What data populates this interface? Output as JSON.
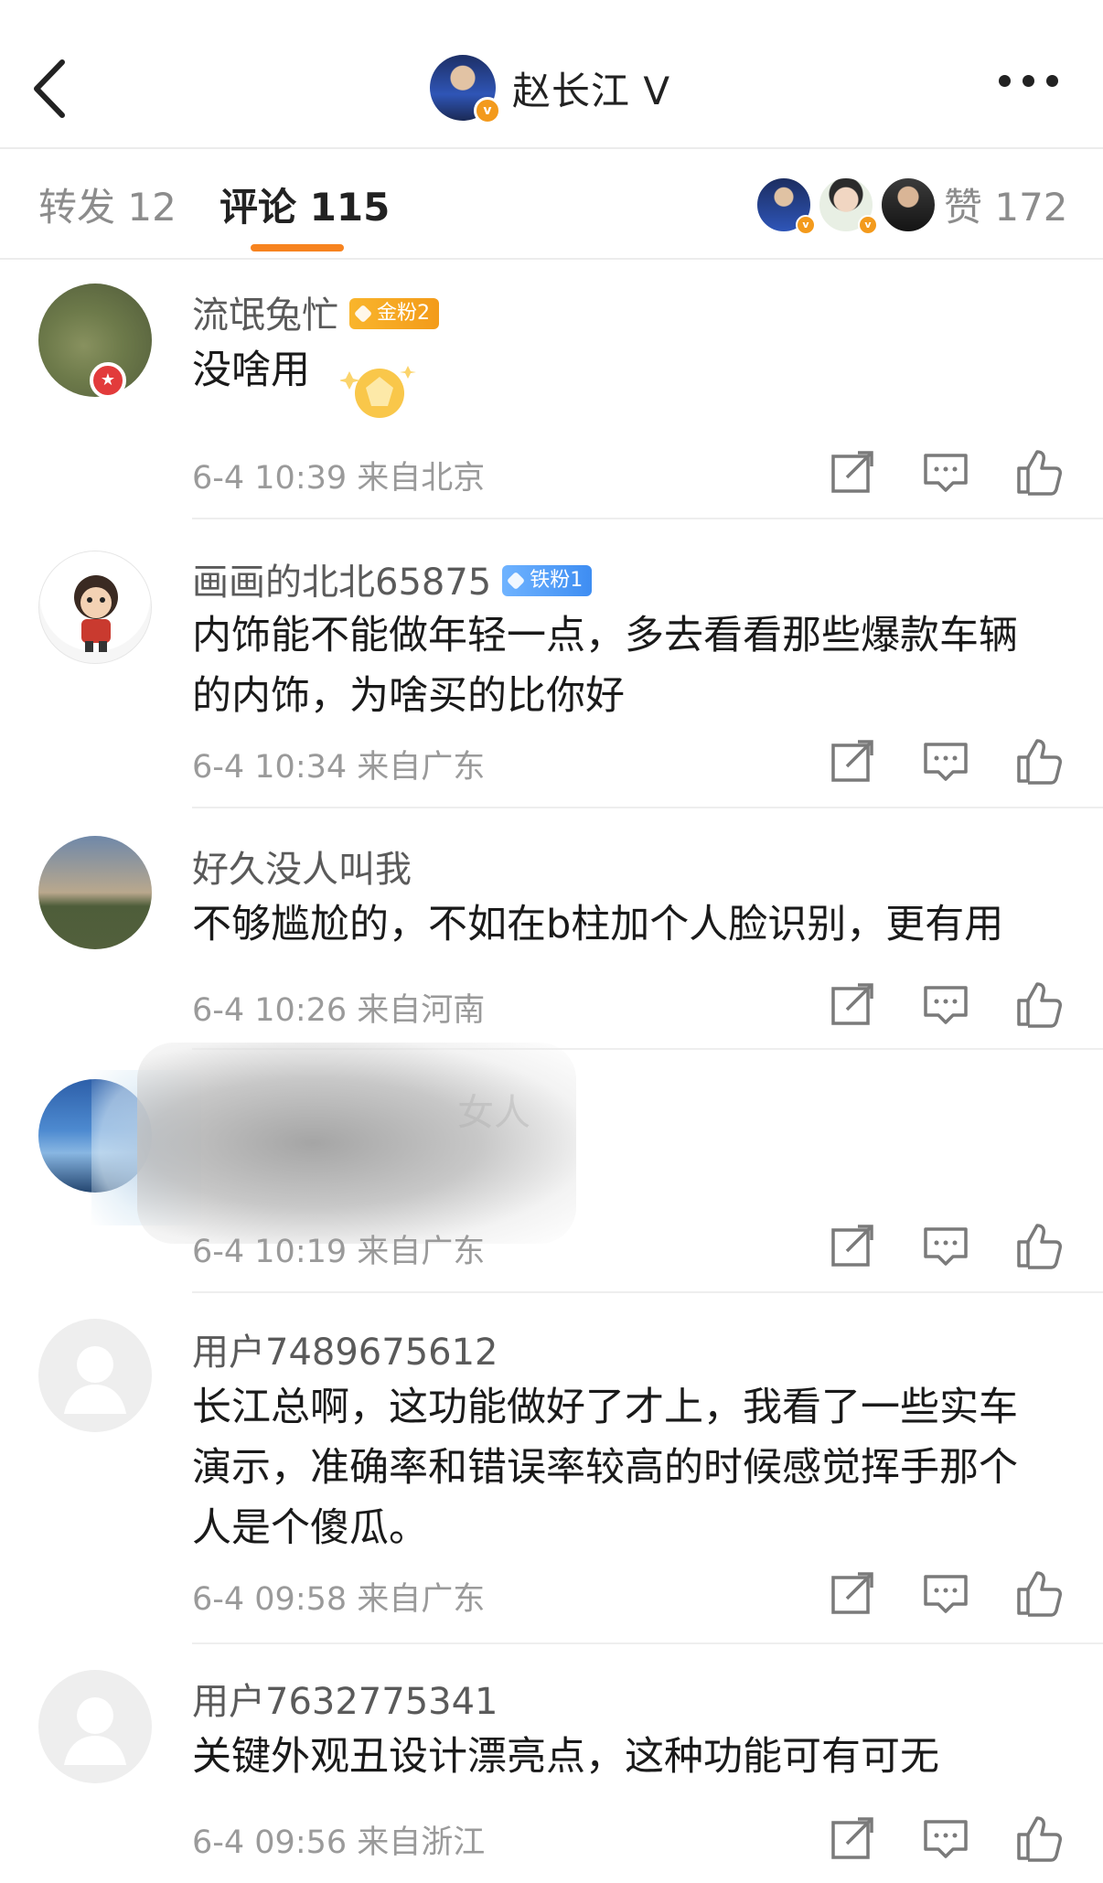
{
  "header": {
    "title": "赵长江",
    "verified_mark": "V",
    "avatar_badge": "v",
    "back_icon": "chevron-left-icon",
    "more_icon": "more-dots-icon"
  },
  "tabs": {
    "repost": "转发 12",
    "comments": "评论 115",
    "likes": "赞 172",
    "accent_color": "#f7831f"
  },
  "comments": [
    {
      "username": "流氓兔忙",
      "fan_badge": "金粉2",
      "text": "没啥用",
      "meta": "6-4 10:39 来自北京"
    },
    {
      "username": "画画的北北65875",
      "fan_badge": "铁粉1",
      "text": "内饰能不能做年轻一点，多去看看那些爆款车辆的内饰，为啥买的比你好",
      "meta": "6-4 10:34 来自广东"
    },
    {
      "username": "好久没人叫我",
      "text": "不够尴尬的，不如在b柱加个人脸识别，更有用",
      "meta": "6-4 10:26 来自河南"
    },
    {
      "username": "女人",
      "text": "",
      "meta": "6-4 10:19 来自广东"
    },
    {
      "username": "用户7489675612",
      "text": "长江总啊，这功能做好了才上，我看了一些实车演示，准确率和错误率较高的时候感觉挥手那个人是个傻瓜。",
      "meta": "6-4 09:58 来自广东"
    },
    {
      "username": "用户7632775341",
      "text": "关键外观丑设计漂亮点，这种功能可有可无",
      "meta": "6-4 09:56 来自浙江"
    }
  ]
}
